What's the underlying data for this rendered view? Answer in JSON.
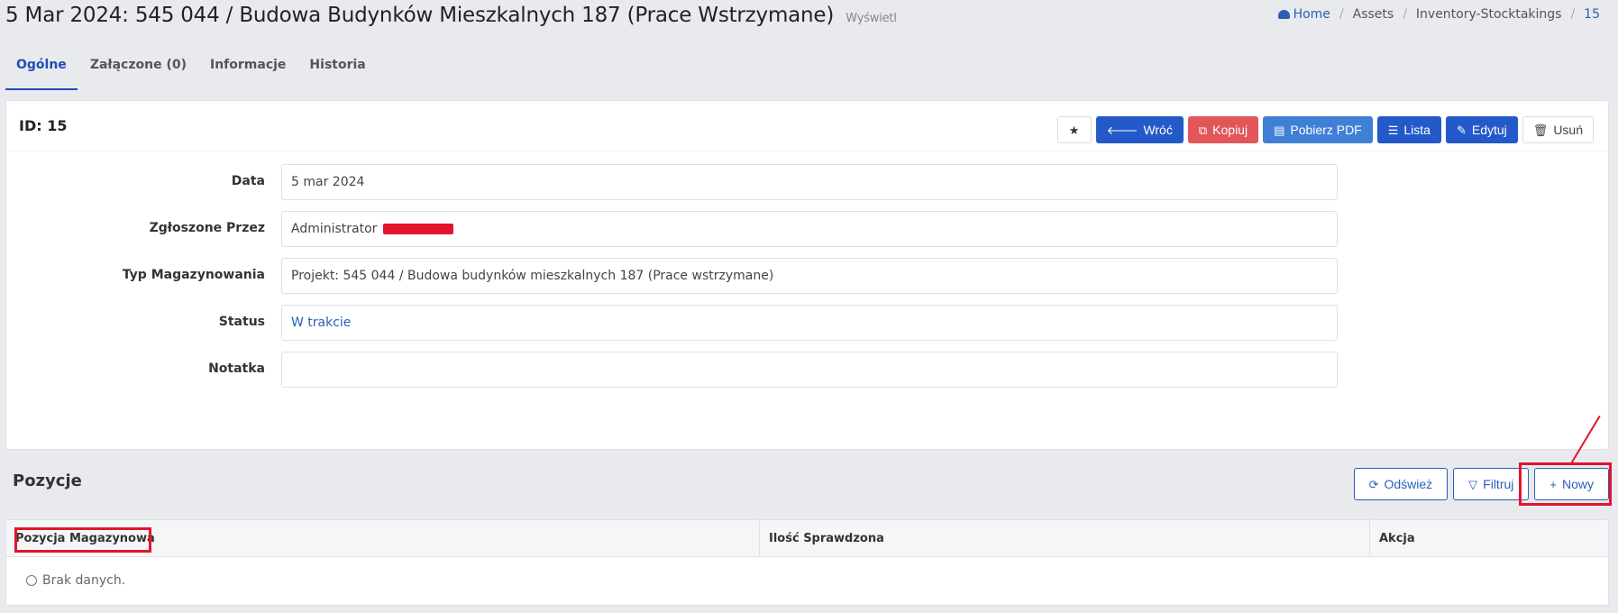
{
  "header": {
    "title": "5 Mar 2024: 545 044 / Budowa Budynków Mieszkalnych 187 (Prace Wstrzymane)",
    "subtitle": "Wyświetl"
  },
  "breadcrumb": {
    "home": "Home",
    "items": [
      "Assets",
      "Inventory-Stocktakings",
      "15"
    ]
  },
  "tabs": [
    {
      "label": "Ogólne",
      "active": true
    },
    {
      "label": "Załączone (0)",
      "active": false
    },
    {
      "label": "Informacje",
      "active": false
    },
    {
      "label": "Historia",
      "active": false
    }
  ],
  "card": {
    "id_label": "ID: 15",
    "toolbar": {
      "back": "Wróć",
      "copy": "Kopiuj",
      "pdf": "Pobierz PDF",
      "list": "Lista",
      "edit": "Edytuj",
      "delete": "Usuń"
    },
    "fields": {
      "data_label": "Data",
      "data_value": "5 mar 2024",
      "reported_label": "Zgłoszone Przez",
      "reported_value": "Administrator",
      "type_label": "Typ Magazynowania",
      "type_value": "Projekt: 545 044 / Budowa budynków mieszkalnych 187 (Prace wstrzymane)",
      "status_label": "Status",
      "status_value": "W trakcie",
      "note_label": "Notatka",
      "note_value": ""
    }
  },
  "positions": {
    "title": "Pozycje",
    "refresh": "Odśwież",
    "filter": "Filtruj",
    "new": "Nowy",
    "columns": [
      "Pozycja Magazynowa",
      "Ilość Sprawdzona",
      "Akcja"
    ],
    "empty": "Brak danych."
  },
  "colors": {
    "primary": "#2459c9",
    "danger": "#e2565a",
    "annotation": "#e3142c"
  }
}
